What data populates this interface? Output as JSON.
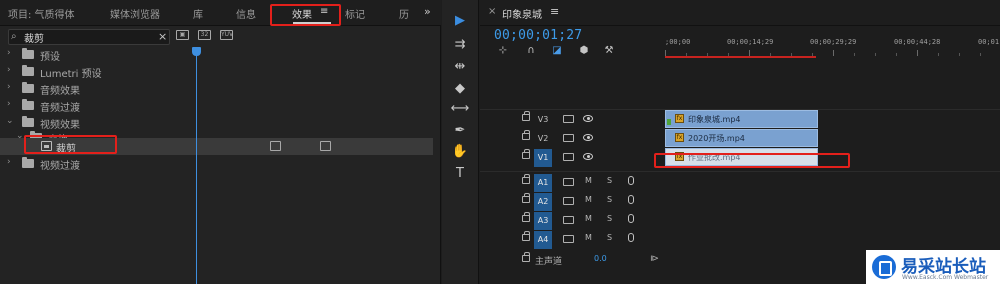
{
  "left_panel": {
    "tabs": [
      {
        "label": "项目: 气质得体"
      },
      {
        "label": "媒体浏览器"
      },
      {
        "label": "库"
      },
      {
        "label": "信息"
      },
      {
        "label": "效果"
      },
      {
        "label": "≡"
      },
      {
        "label": "标记"
      },
      {
        "label": "历"
      }
    ],
    "overflow_label": "»",
    "search": {
      "value": "裁剪",
      "clear_label": "×"
    },
    "bins": [
      {
        "icon": "accelerated-effects-icon"
      },
      {
        "icon": "32bit-effects-icon"
      },
      {
        "icon": "yuv-effects-icon"
      }
    ],
    "tree": [
      {
        "label": "预设"
      },
      {
        "label": "Lumetri 预设"
      },
      {
        "label": "音频效果"
      },
      {
        "label": "音频过渡"
      },
      {
        "label": "视频效果"
      },
      {
        "label": "变换"
      },
      {
        "label": "裁剪"
      },
      {
        "label": "视频过渡"
      }
    ]
  },
  "tools": [
    {
      "name": "selection-tool-icon",
      "glyph": "▶"
    },
    {
      "name": "track-select-tool-icon",
      "glyph": "⇉"
    },
    {
      "name": "ripple-edit-tool-icon",
      "glyph": "⇹"
    },
    {
      "name": "razor-tool-icon",
      "glyph": "◆"
    },
    {
      "name": "slip-tool-icon",
      "glyph": "⟷"
    },
    {
      "name": "pen-tool-icon",
      "glyph": "✒"
    },
    {
      "name": "hand-tool-icon",
      "glyph": "✋"
    },
    {
      "name": "type-tool-icon",
      "glyph": "T"
    }
  ],
  "timeline": {
    "close_label": "×",
    "sequence_title": "印象泉城",
    "menu_label": "≡",
    "timecode": "00;00;01;27",
    "ruler_labels": [
      ";00;00",
      "00;00;14;29",
      "00;00;29;29",
      "00;00;44;28",
      "00;01"
    ],
    "video_tracks": [
      {
        "name": "V3",
        "clip": "印象泉城.mp4"
      },
      {
        "name": "V2",
        "clip": "2020开场.mp4"
      },
      {
        "name": "V1",
        "clip": "作业批改.mp4"
      }
    ],
    "audio_tracks": [
      {
        "name": "A1",
        "m": "M",
        "s": "S"
      },
      {
        "name": "A2",
        "m": "M",
        "s": "S"
      },
      {
        "name": "A3",
        "m": "M",
        "s": "S"
      },
      {
        "name": "A4",
        "m": "M",
        "s": "S"
      }
    ],
    "master": {
      "label": "主声道",
      "value": "0.0"
    }
  },
  "watermark": {
    "text": "易采站长站",
    "sub": "Www.Easck.Com Webmaster"
  },
  "colors": {
    "accent": "#3d9be9",
    "annotation": "#e3201b",
    "clip": "#7aa1d0",
    "track_target": "#225a91"
  }
}
